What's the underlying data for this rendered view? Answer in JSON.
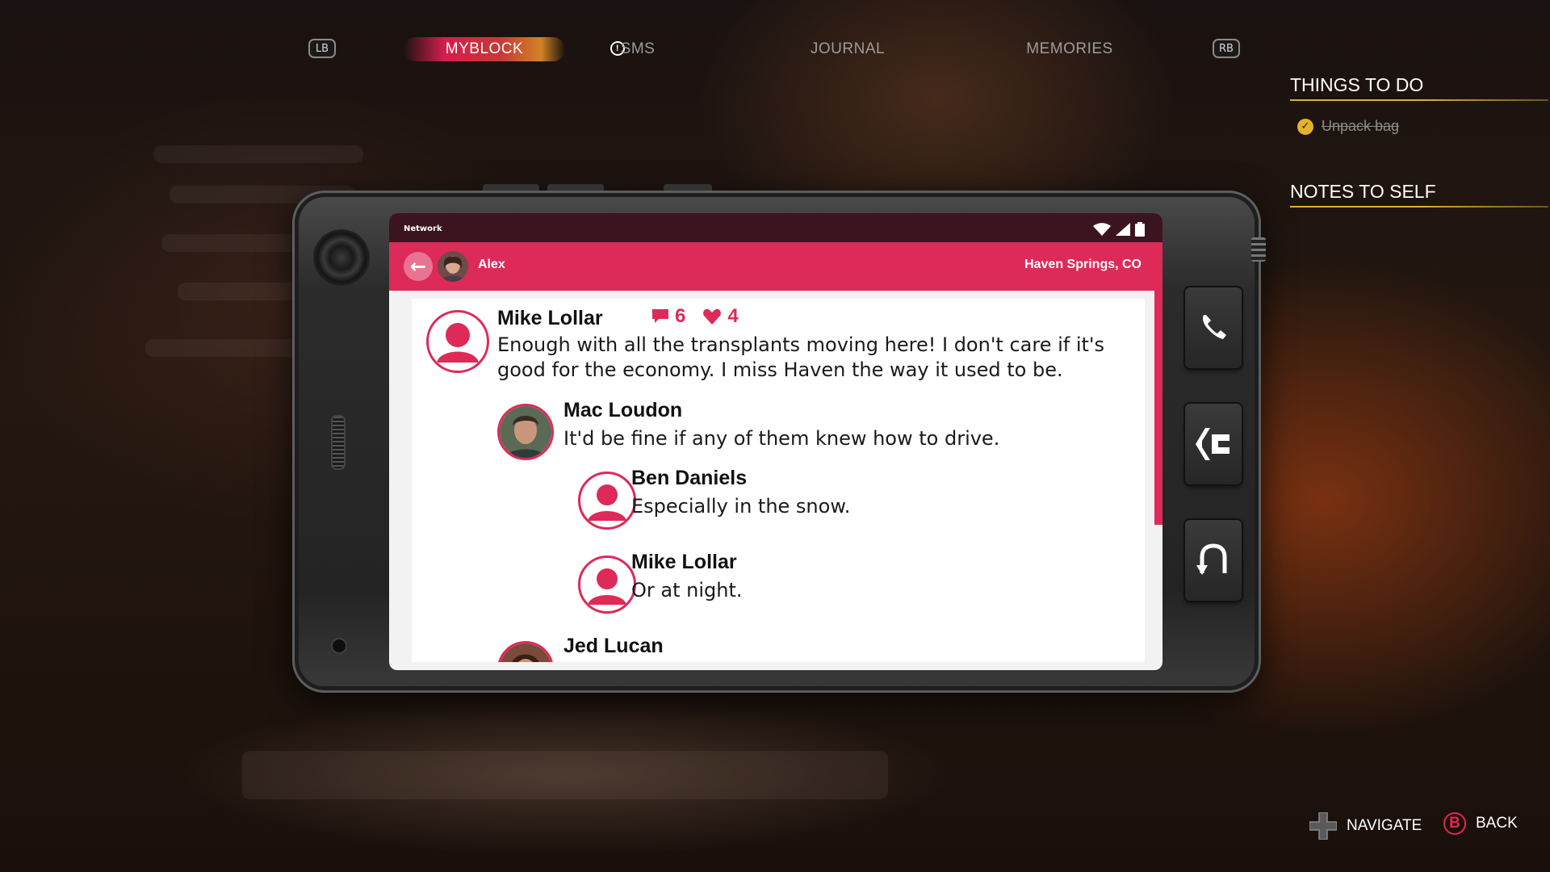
{
  "nav": {
    "lb_label": "LB",
    "rb_label": "RB",
    "tabs": [
      {
        "label": "MYBLOCK",
        "active": true,
        "alert": true
      },
      {
        "label": "SMS",
        "active": false
      },
      {
        "label": "JOURNAL",
        "active": false
      },
      {
        "label": "MEMORIES",
        "active": false
      }
    ]
  },
  "side_panel": {
    "things_to_do_title": "THINGS TO DO",
    "todo_items": [
      {
        "label": "Unpack bag",
        "done": true,
        "icon": "check-icon"
      }
    ],
    "notes_title": "NOTES TO SELF"
  },
  "phone": {
    "status_bar": {
      "network_label": "Network",
      "icons": [
        "wifi-icon",
        "signal-icon",
        "battery-icon"
      ]
    },
    "header": {
      "user_name": "Alex",
      "location": "Haven Springs, CO",
      "accent_color": "#de2a58"
    },
    "post": {
      "author": "Mike Lollar",
      "comment_count": "6",
      "like_count": "4",
      "text": "Enough with all the transplants moving here! I don't care if it's good for the economy. I miss Haven the way it used to be."
    },
    "replies": [
      {
        "author": "Mac Loudon",
        "text": "It'd be fine if any of them knew how to drive.",
        "avatar": "photo"
      },
      {
        "author": "Ben Daniels",
        "text": "Especially in the snow.",
        "avatar": "default"
      },
      {
        "author": "Mike Lollar",
        "text": "Or at night.",
        "avatar": "default"
      },
      {
        "author": "Jed Lucan",
        "text": "",
        "avatar": "photo"
      }
    ],
    "side_keys": [
      "phone-call-icon",
      "share-icon",
      "return-icon"
    ]
  },
  "footer": {
    "navigate_label": "NAVIGATE",
    "back_label": "BACK",
    "back_button": "B"
  }
}
